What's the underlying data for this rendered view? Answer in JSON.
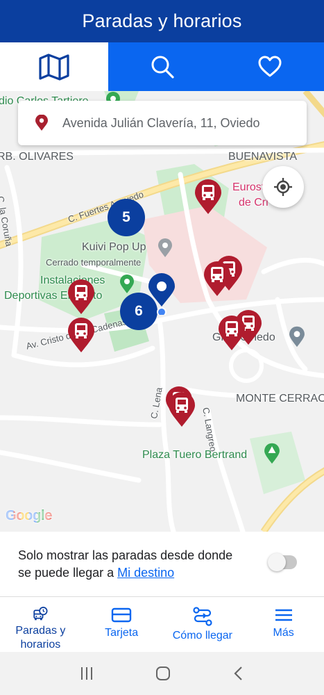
{
  "header": {
    "title": "Paradas y horarios"
  },
  "tabs": [
    {
      "name": "map",
      "icon": "map-icon",
      "active": true
    },
    {
      "name": "search",
      "icon": "search-icon",
      "active": false
    },
    {
      "name": "favorites",
      "icon": "heart-icon",
      "active": false
    }
  ],
  "map": {
    "address": "Avenida Julián Clavería, 11, Oviedo",
    "clusters": [
      "5",
      "6"
    ],
    "labels": {
      "olivares": "RB. OLIVARES",
      "buenavista": "BUENAVISTA",
      "coruna": "C. la Coruña",
      "fuertes": "C. Fuertes Acevedo",
      "kuivi": "Kuivi Pop Up",
      "cerrado": "Cerrado temporalmente",
      "instalaciones1": "Instalaciones",
      "instalaciones2": "Deportivas El Cristo",
      "cristo": "Av. Cristo de las Cadenas",
      "hotel": "Gran Oviedo",
      "monte": "MONTE CERRAO",
      "lena": "C. Lena",
      "langreo": "C. Langreo",
      "plaza": "Plaza Tuero Bertrand",
      "top": "dio Carlos Tartiere",
      "eurostars1": "Eurostars Pa",
      "eurostars2": "de Cri"
    },
    "attribution": "Google",
    "colors": {
      "stop_pin": "#b01c2e",
      "cluster": "#0b3f9f",
      "accent": "#0a66f0"
    }
  },
  "filter": {
    "text_line1": "Solo mostrar las paradas desde donde",
    "text_line2": "se puede llegar a ",
    "link": "Mi destino",
    "toggle_on": false
  },
  "bottom_nav": [
    {
      "label_line1": "Paradas y",
      "label_line2": "horarios",
      "icon": "bus-clock-icon"
    },
    {
      "label_line1": "Tarjeta",
      "label_line2": "",
      "icon": "card-icon"
    },
    {
      "label_line1": "Cómo llegar",
      "label_line2": "",
      "icon": "route-icon"
    },
    {
      "label_line1": "Más",
      "label_line2": "",
      "icon": "menu-icon"
    }
  ],
  "system_nav": [
    "recents-icon",
    "home-icon",
    "back-icon"
  ]
}
